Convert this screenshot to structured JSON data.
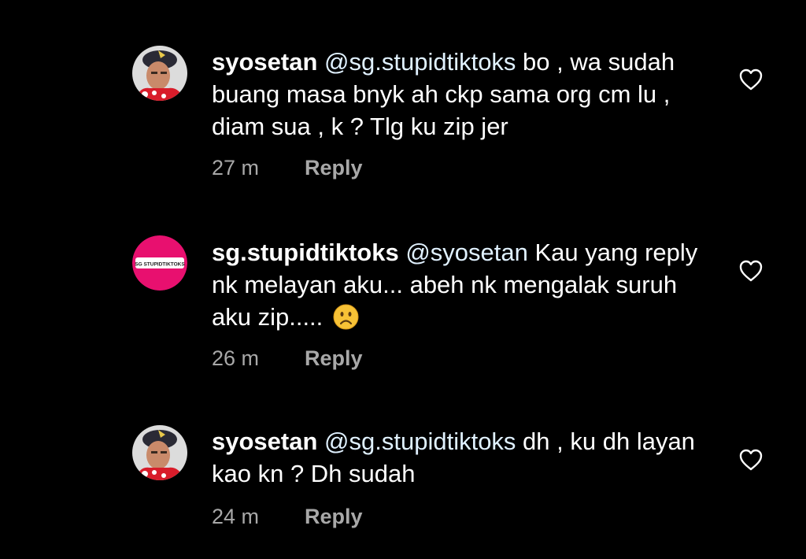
{
  "comments": [
    {
      "username": "syosetan",
      "mention": "@sg.stupidtiktoks",
      "text": " bo , wa sudah buang masa bnyk ah ckp sama org cm lu , diam sua , k ? Tlg ku zip jer",
      "time": "27 m",
      "reply_label": "Reply",
      "avatar_icon": "user-avatar-icon",
      "like_icon": "heart-outline-icon"
    },
    {
      "username": "sg.stupidtiktoks",
      "mention": "@syosetan",
      "text": " Kau yang reply nk melayan aku... abeh nk mengalak suruh aku zip.....",
      "emoji": "frowning-face-icon",
      "time": "26 m",
      "reply_label": "Reply",
      "avatar_icon": "brand-logo-avatar-icon",
      "avatar_text": "SG STUPIDTIKTOKS",
      "like_icon": "heart-outline-icon"
    },
    {
      "username": "syosetan",
      "mention": "@sg.stupidtiktoks",
      "text": " dh , ku dh layan kao kn ? Dh sudah",
      "time": "24 m",
      "reply_label": "Reply",
      "avatar_icon": "user-avatar-icon",
      "like_icon": "heart-outline-icon"
    }
  ],
  "colors": {
    "background": "#000000",
    "text": "#ffffff",
    "mention": "#e0f1ff",
    "meta": "#a8a8a8",
    "brand_pink": "#e8106f"
  }
}
